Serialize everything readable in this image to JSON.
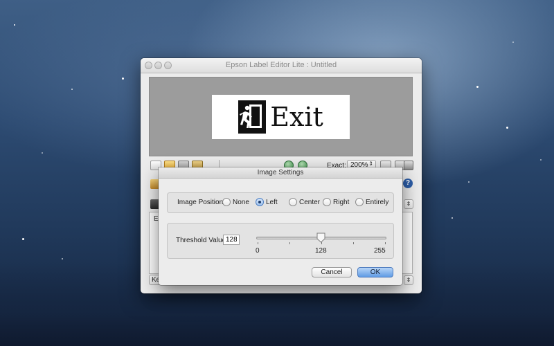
{
  "window": {
    "title": "Epson Label Editor Lite : Untitled"
  },
  "label_preview": {
    "text": "Exit",
    "icon": "running-man-exit-icon"
  },
  "toolbar": {
    "zoom_label": "Exact:",
    "zoom_value": "200%",
    "icons": [
      "new-file-icon",
      "open-folder-icon",
      "save-icon",
      "image-icon",
      "zoom-out-icon",
      "zoom-in-icon",
      "tape-icon",
      "tools-icon",
      "print-icon"
    ]
  },
  "background": {
    "panel_text": "Ex",
    "bottom_select": "Ke",
    "help_icon": "help-icon"
  },
  "dialog": {
    "title": "Image Settings",
    "position_label": "Image Position:",
    "positions": [
      {
        "label": "None",
        "selected": false
      },
      {
        "label": "Left",
        "selected": true
      },
      {
        "label": "Center",
        "selected": false
      },
      {
        "label": "Right",
        "selected": false
      },
      {
        "label": "Entirely",
        "selected": false
      }
    ],
    "threshold_label": "Threshold Value:",
    "threshold_value": "128",
    "slider": {
      "min": "0",
      "mid": "128",
      "max": "255",
      "value": 128
    },
    "cancel_label": "Cancel",
    "ok_label": "OK"
  }
}
